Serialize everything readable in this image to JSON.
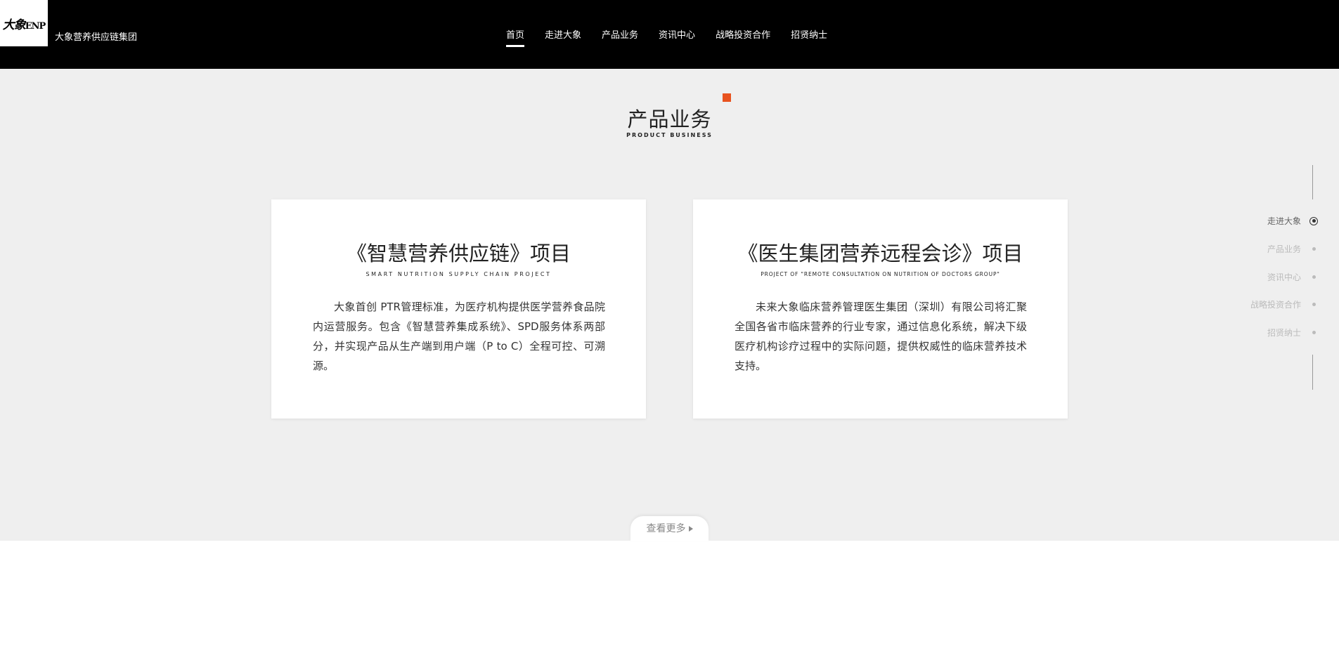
{
  "header": {
    "logo_text": "ENP",
    "logo_cn": "大象",
    "brand_name": "大象营养供应链集团",
    "nav": [
      {
        "label": "首页",
        "active": true
      },
      {
        "label": "走进大象"
      },
      {
        "label": "产品业务"
      },
      {
        "label": "资讯中心"
      },
      {
        "label": "战略投资合作"
      },
      {
        "label": "招贤纳士"
      }
    ]
  },
  "section": {
    "title": "产品业务",
    "subtitle": "PRODUCT BUSINESS",
    "accent_color": "#e8531f",
    "cards": [
      {
        "title": "《智慧营养供应链》项目",
        "subtitle": "SMART NUTRITION SUPPLY CHAIN PROJECT",
        "description": "大象首创 PTR管理标准，为医疗机构提供医学营养食品院内运营服务。包含《智慧营养集成系统》、SPD服务体系两部分，并实现产品从生产端到用户端（P to C）全程可控、可溯源。"
      },
      {
        "title": "《医生集团营养远程会诊》项目",
        "subtitle": "PROJECT OF \"REMOTE CONSULTATION ON NUTRITION OF DOCTORS GROUP\"",
        "description": "未来大象临床营养管理医生集团（深圳）有限公司将汇聚全国各省市临床营养的行业专家，通过信息化系统，解决下级医疗机构诊疗过程中的实际问题，提供权威性的临床营养技术支持。"
      }
    ],
    "more_label": "查看更多"
  },
  "side_nav": [
    {
      "label": "走进大象",
      "active": true
    },
    {
      "label": "产品业务"
    },
    {
      "label": "资讯中心"
    },
    {
      "label": "战略投资合作"
    },
    {
      "label": "招贤纳士"
    }
  ]
}
